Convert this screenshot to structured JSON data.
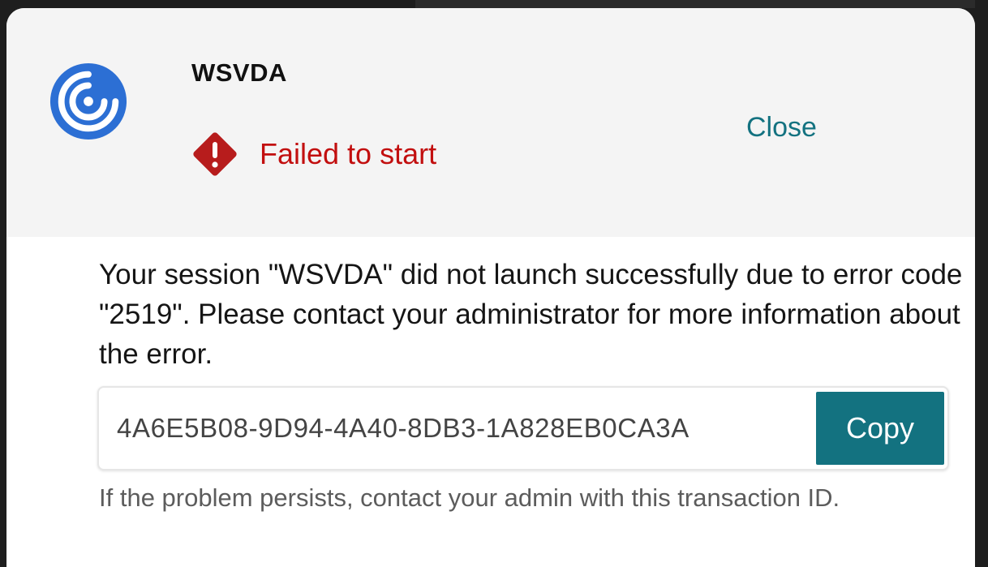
{
  "dialog": {
    "app_name": "WSVDA",
    "status": "Failed to start",
    "close_label": "Close",
    "message": "Your session \"WSVDA\" did not launch successfully due to error code \"2519\". Please contact your administrator for more information about the error.",
    "transaction_id": "4A6E5B08-9D94-4A40-8DB3-1A828EB0CA3A",
    "copy_label": "Copy",
    "hint": "If the problem persists, contact your admin with this transaction ID."
  },
  "icons": {
    "app_logo": "citrix-workspace-logo-icon",
    "status": "error-diamond-icon"
  },
  "colors": {
    "accent": "#137280",
    "error": "#c20f0f",
    "logo_blue": "#2c6fd4",
    "header_bg": "#f4f4f4"
  }
}
